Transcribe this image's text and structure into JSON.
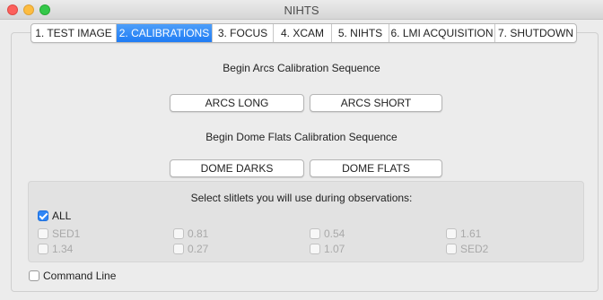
{
  "window": {
    "title": "NIHTS"
  },
  "tabs": [
    {
      "label": "1. TEST IMAGE",
      "active": false
    },
    {
      "label": "2. CALIBRATIONS",
      "active": true
    },
    {
      "label": "3. FOCUS",
      "active": false
    },
    {
      "label": "4. XCAM",
      "active": false
    },
    {
      "label": "5. NIHTS",
      "active": false
    },
    {
      "label": "6. LMI ACQUISITION",
      "active": false
    },
    {
      "label": "7. SHUTDOWN",
      "active": false
    }
  ],
  "arcs": {
    "heading": "Begin Arcs Calibration Sequence",
    "long_label": "ARCS LONG",
    "short_label": "ARCS SHORT"
  },
  "flats": {
    "heading": "Begin Dome Flats Calibration Sequence",
    "darks_label": "DOME DARKS",
    "flats_label": "DOME FLATS"
  },
  "slitlets": {
    "heading": "Select slitlets you will use during observations:",
    "all_label": "ALL",
    "all_checked": true,
    "items": [
      "SED1",
      "0.81",
      "0.54",
      "1.61",
      "1.34",
      "0.27",
      "1.07",
      "SED2"
    ]
  },
  "command_line": {
    "label": "Command Line",
    "checked": false
  },
  "colors": {
    "accent": "#1f7cf4",
    "background": "#ececec",
    "group_bg": "#e2e2e2"
  }
}
